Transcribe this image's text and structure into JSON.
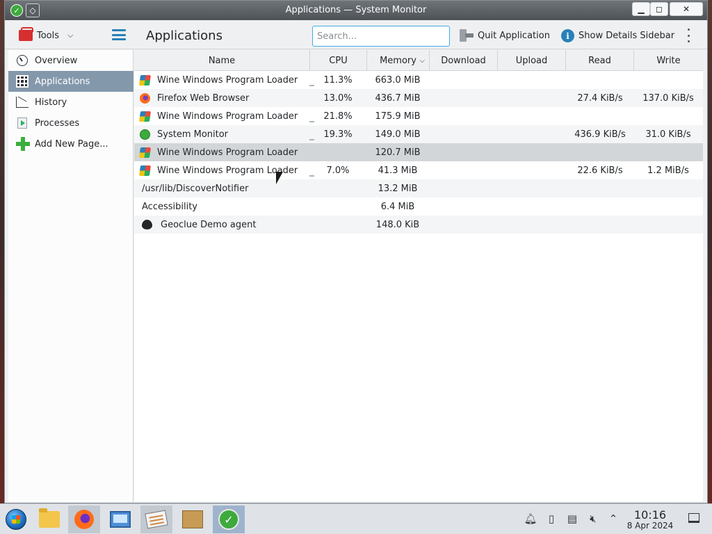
{
  "window": {
    "title": "Applications — System Monitor",
    "min_glyph": "▁",
    "max_glyph": "◻",
    "close_glyph": "✕",
    "keep_glyph": "◇"
  },
  "toolbar": {
    "tools_label": "Tools",
    "page_title": "Applications",
    "search_placeholder": "Search...",
    "quit_label": "Quit Application",
    "details_label": "Show Details Sidebar"
  },
  "sidebar": {
    "items": [
      {
        "label": "Overview",
        "icon": "overview-gauge-icon"
      },
      {
        "label": "Applications",
        "icon": "apps-grid-icon",
        "active": true
      },
      {
        "label": "History",
        "icon": "chart-icon"
      },
      {
        "label": "Processes",
        "icon": "process-icon"
      },
      {
        "label": "Add New Page...",
        "icon": "plus-icon"
      }
    ]
  },
  "table": {
    "columns": [
      "Name",
      "CPU",
      "Memory",
      "Download",
      "Upload",
      "Read",
      "Write"
    ],
    "sort_column": "Memory",
    "rows": [
      {
        "name": "Wine Windows Program Loader",
        "icon": "wine-icon",
        "cpu": "11.3%",
        "memory": "663.0 MiB",
        "read": "",
        "write": ""
      },
      {
        "name": "Firefox Web Browser",
        "icon": "firefox-icon",
        "cpu": "13.0%",
        "memory": "436.7 MiB",
        "read": "27.4 KiB/s",
        "write": "137.0 KiB/s"
      },
      {
        "name": "Wine Windows Program Loader",
        "icon": "wine-icon",
        "cpu": "21.8%",
        "memory": "175.9 MiB",
        "read": "",
        "write": ""
      },
      {
        "name": "System Monitor",
        "icon": "system-monitor-icon",
        "cpu": "19.3%",
        "memory": "149.0 MiB",
        "read": "436.9 KiB/s",
        "write": "31.0 KiB/s"
      },
      {
        "name": "Wine Windows Program Loader",
        "icon": "wine-icon",
        "cpu": "",
        "memory": "120.7 MiB",
        "read": "",
        "write": "",
        "selected": true
      },
      {
        "name": "Wine Windows Program Loader",
        "icon": "wine-icon",
        "cpu": "7.0%",
        "memory": "41.3 MiB",
        "read": "22.6 KiB/s",
        "write": "1.2 MiB/s"
      },
      {
        "name": "/usr/lib/DiscoverNotifier",
        "icon": "",
        "cpu": "",
        "memory": "13.2 MiB",
        "read": "",
        "write": ""
      },
      {
        "name": "Accessibility",
        "icon": "",
        "cpu": "",
        "memory": "6.4 MiB",
        "read": "",
        "write": ""
      },
      {
        "name": "Geoclue Demo agent",
        "icon": "location-pin-icon",
        "cpu": "",
        "memory": "148.0 KiB",
        "read": "",
        "write": ""
      }
    ]
  },
  "taskbar": {
    "apps": [
      "start-menu",
      "file-manager",
      "firefox",
      "remote-desktop",
      "text-editor",
      "package-installer",
      "system-monitor"
    ],
    "clock_time": "10:16",
    "clock_date": "8 Apr 2024"
  }
}
